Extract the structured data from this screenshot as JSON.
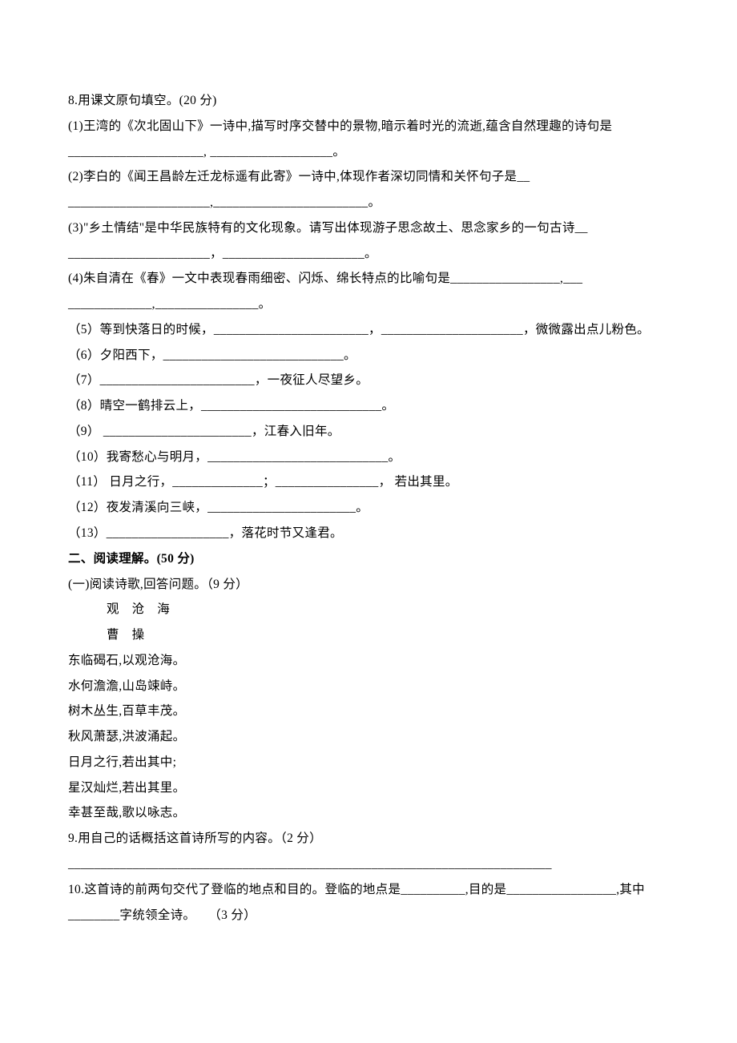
{
  "q8": {
    "stem": "8.用课文原句填空。(20 分)",
    "items": [
      "(1)王湾的《次北固山下》一诗中,描写时序交替中的景物,暗示着时光的流逝,蕴含自然理趣的诗句是_____________________, ___________________。",
      "(2)李白的《闻王昌龄左迁龙标遥有此寄》一诗中,体现作者深切同情和关怀句子是__",
      "______________________,________________________。",
      "(3)\"乡土情结\"是中华民族特有的文化现象。请写出体现游子思念故土、思念家乡的一句古诗__",
      "______________________，______________________。",
      "(4)朱自清在《春》一文中表现春雨细密、闪烁、绵长特点的比喻句是_________________,___",
      "_____________,________________。",
      "（5）等到快落日的时候，________________________，______________________，微微露出点儿粉色。",
      "（6）夕阳西下，____________________________。",
      "（7）________________________，一夜征人尽望乡。",
      "（8）晴空一鹤排云上，____________________________。",
      "（9）  _______________________，江春入旧年。",
      "（10）我寄愁心与明月，____________________________。",
      "（11）  日月之行，______________；________________， 若出其里。",
      "（12）夜发清溪向三峡，_______________________。",
      "（13）___________________，落花时节又逢君。"
    ]
  },
  "section2": {
    "title": "二、阅读理解。(50 分)",
    "part1": {
      "intro": "(一)阅读诗歌,回答问题。（9 分）",
      "poem_title": "观　沧　海",
      "poem_author": "曹　操",
      "poem_lines": [
        "东临碣石,以观沧海。",
        "水何澹澹,山岛竦峙。",
        "树木丛生,百草丰茂。",
        "秋风萧瑟,洪波涌起。",
        "日月之行,若出其中;",
        "星汉灿烂,若出其里。",
        "幸甚至哉,歌以咏志。"
      ]
    },
    "q9": "9.用自己的话概括这首诗所写的内容。（2 分）",
    "q9_blank": "___________________________________________________________________________",
    "q10": "10.这首诗的前两句交代了登临的地点和目的。登临的地点是__________,目的是_________________,其中________字统领全诗。　　（3 分）"
  }
}
